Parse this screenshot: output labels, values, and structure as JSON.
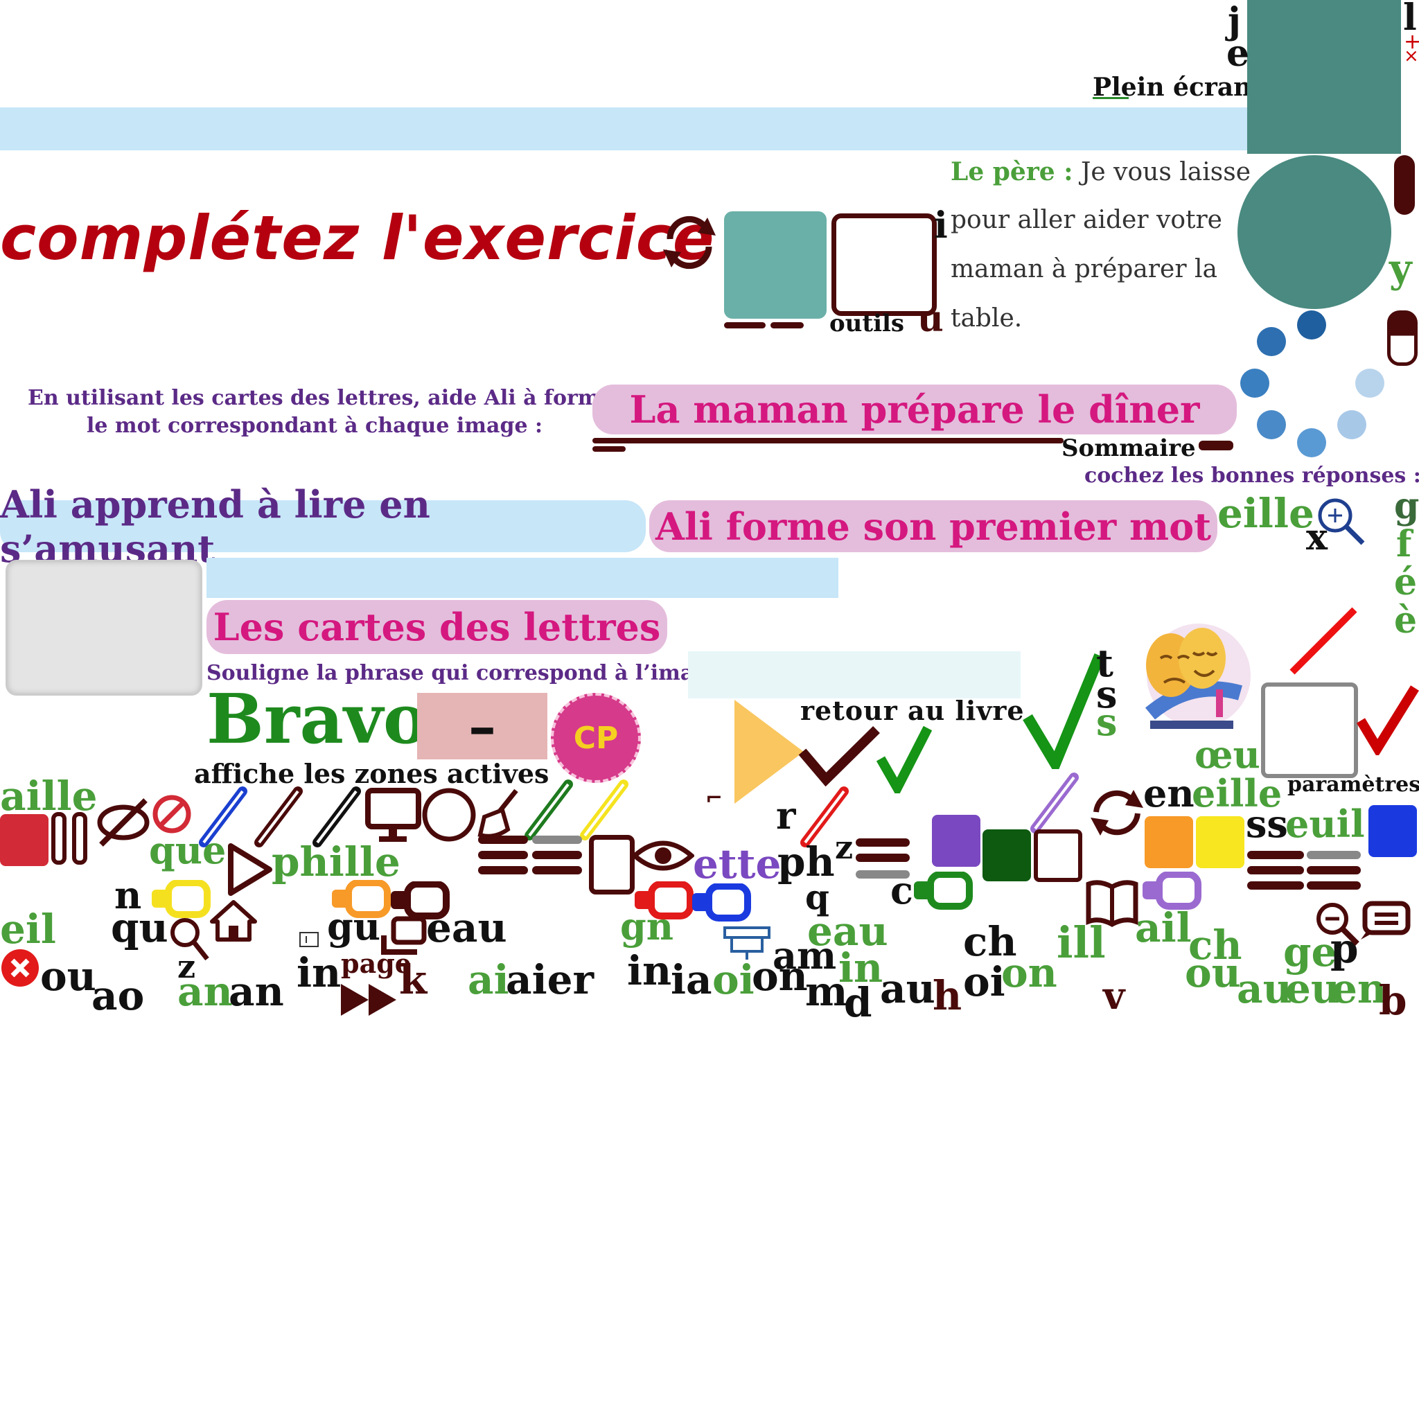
{
  "colors": {
    "teal": "#4a8a80",
    "tealLight": "#6ab0a8",
    "darkRed": "#4a0a0a",
    "titleRed": "#b5000f",
    "green": "#4a9f3a",
    "purple": "#5b2a86",
    "pink": "#d4187f",
    "pillPink": "#e4bddc",
    "pillBlue": "#c7e6f8"
  },
  "top": {
    "fullscreen_label": "Plein écran",
    "letters_right": [
      "j",
      "e",
      "l"
    ]
  },
  "title": "complétez l'exercice",
  "tools_label": "outils",
  "story": {
    "speaker": "Le père :",
    "line1": "Je vous laisse",
    "line2": "pour aller aider votre",
    "line3": "maman à préparer la",
    "line4": "table."
  },
  "instructions": {
    "line1": "En utilisant les cartes des lettres, aide Ali à former",
    "line2": "le mot correspondant à chaque image  :"
  },
  "sections": {
    "maman": "La maman prépare le dîner",
    "sommaire": "Sommaire",
    "cochez": "cochez les bonnes réponses :",
    "ali_lire": "Ali apprend à lire en s’amusant",
    "ali_mot": "Ali forme son premier mot",
    "cartes": "Les cartes des lettres",
    "souligne": "Souligne la phrase qui correspond à l’image :"
  },
  "feedback": {
    "bravo": "Bravo",
    "minus": "–",
    "badge": "CP"
  },
  "nav": {
    "retour": "retour au livre",
    "zones": "affiche les zones actives",
    "parametres": "paramètres",
    "page": "page"
  },
  "icons": [
    "refresh-icon",
    "eye-slash-icon",
    "no-entry-icon",
    "pencil-icon",
    "monitor-icon",
    "circle-icon",
    "broom-icon",
    "play-icon",
    "home-icon",
    "search-icon",
    "fast-forward-icon",
    "tablet-icon",
    "eye-icon",
    "projector-icon",
    "book-icon",
    "zoom-in-icon",
    "zoom-out-icon",
    "close-icon",
    "check-icon",
    "checkbox-icon",
    "menu-icon",
    "magnet-icon",
    "comment-icon"
  ],
  "letters": {
    "aille": "aille",
    "que": "que",
    "phille": "phille",
    "n": "n",
    "qu": "qu",
    "eil": "eil",
    "ou": "ou",
    "ao": "ao",
    "z": "z",
    "an1": "an",
    "an2": "an",
    "gu": "gu",
    "eau1": "eau",
    "in1": "in",
    "k": "k",
    "ai": "ai",
    "aier": "aier",
    "ette": "ette",
    "r": "r",
    "ph": "ph",
    "z2": "z",
    "q": "q",
    "c": "c",
    "gn": "gn",
    "eau2": "eau",
    "in2": "in",
    "ia": "ia",
    "oi1": "oi",
    "on1": "on",
    "am": "am",
    "in3": "in",
    "m": "m",
    "d": "d",
    "au": "au",
    "h": "h",
    "ch1": "ch",
    "oi2": "oi",
    "on2": "on",
    "ill": "ill",
    "v": "v",
    "ail": "ail",
    "ch2": "ch",
    "ou2": "ou",
    "ge": "ge",
    "p": "p",
    "au2": "au",
    "eu": "eu",
    "en": "en",
    "b": "b",
    "oeu": "œu",
    "en2": "en",
    "eille": "eille",
    "ss": "ss",
    "euil": "euil",
    "eille2": "eille",
    "x": "x",
    "g": "g",
    "f": "f",
    "e_acute": "é",
    "e_grave": "è",
    "y": "y",
    "u": "u",
    "i": "i",
    "t": "t",
    "s1": "s",
    "s2": "s"
  }
}
